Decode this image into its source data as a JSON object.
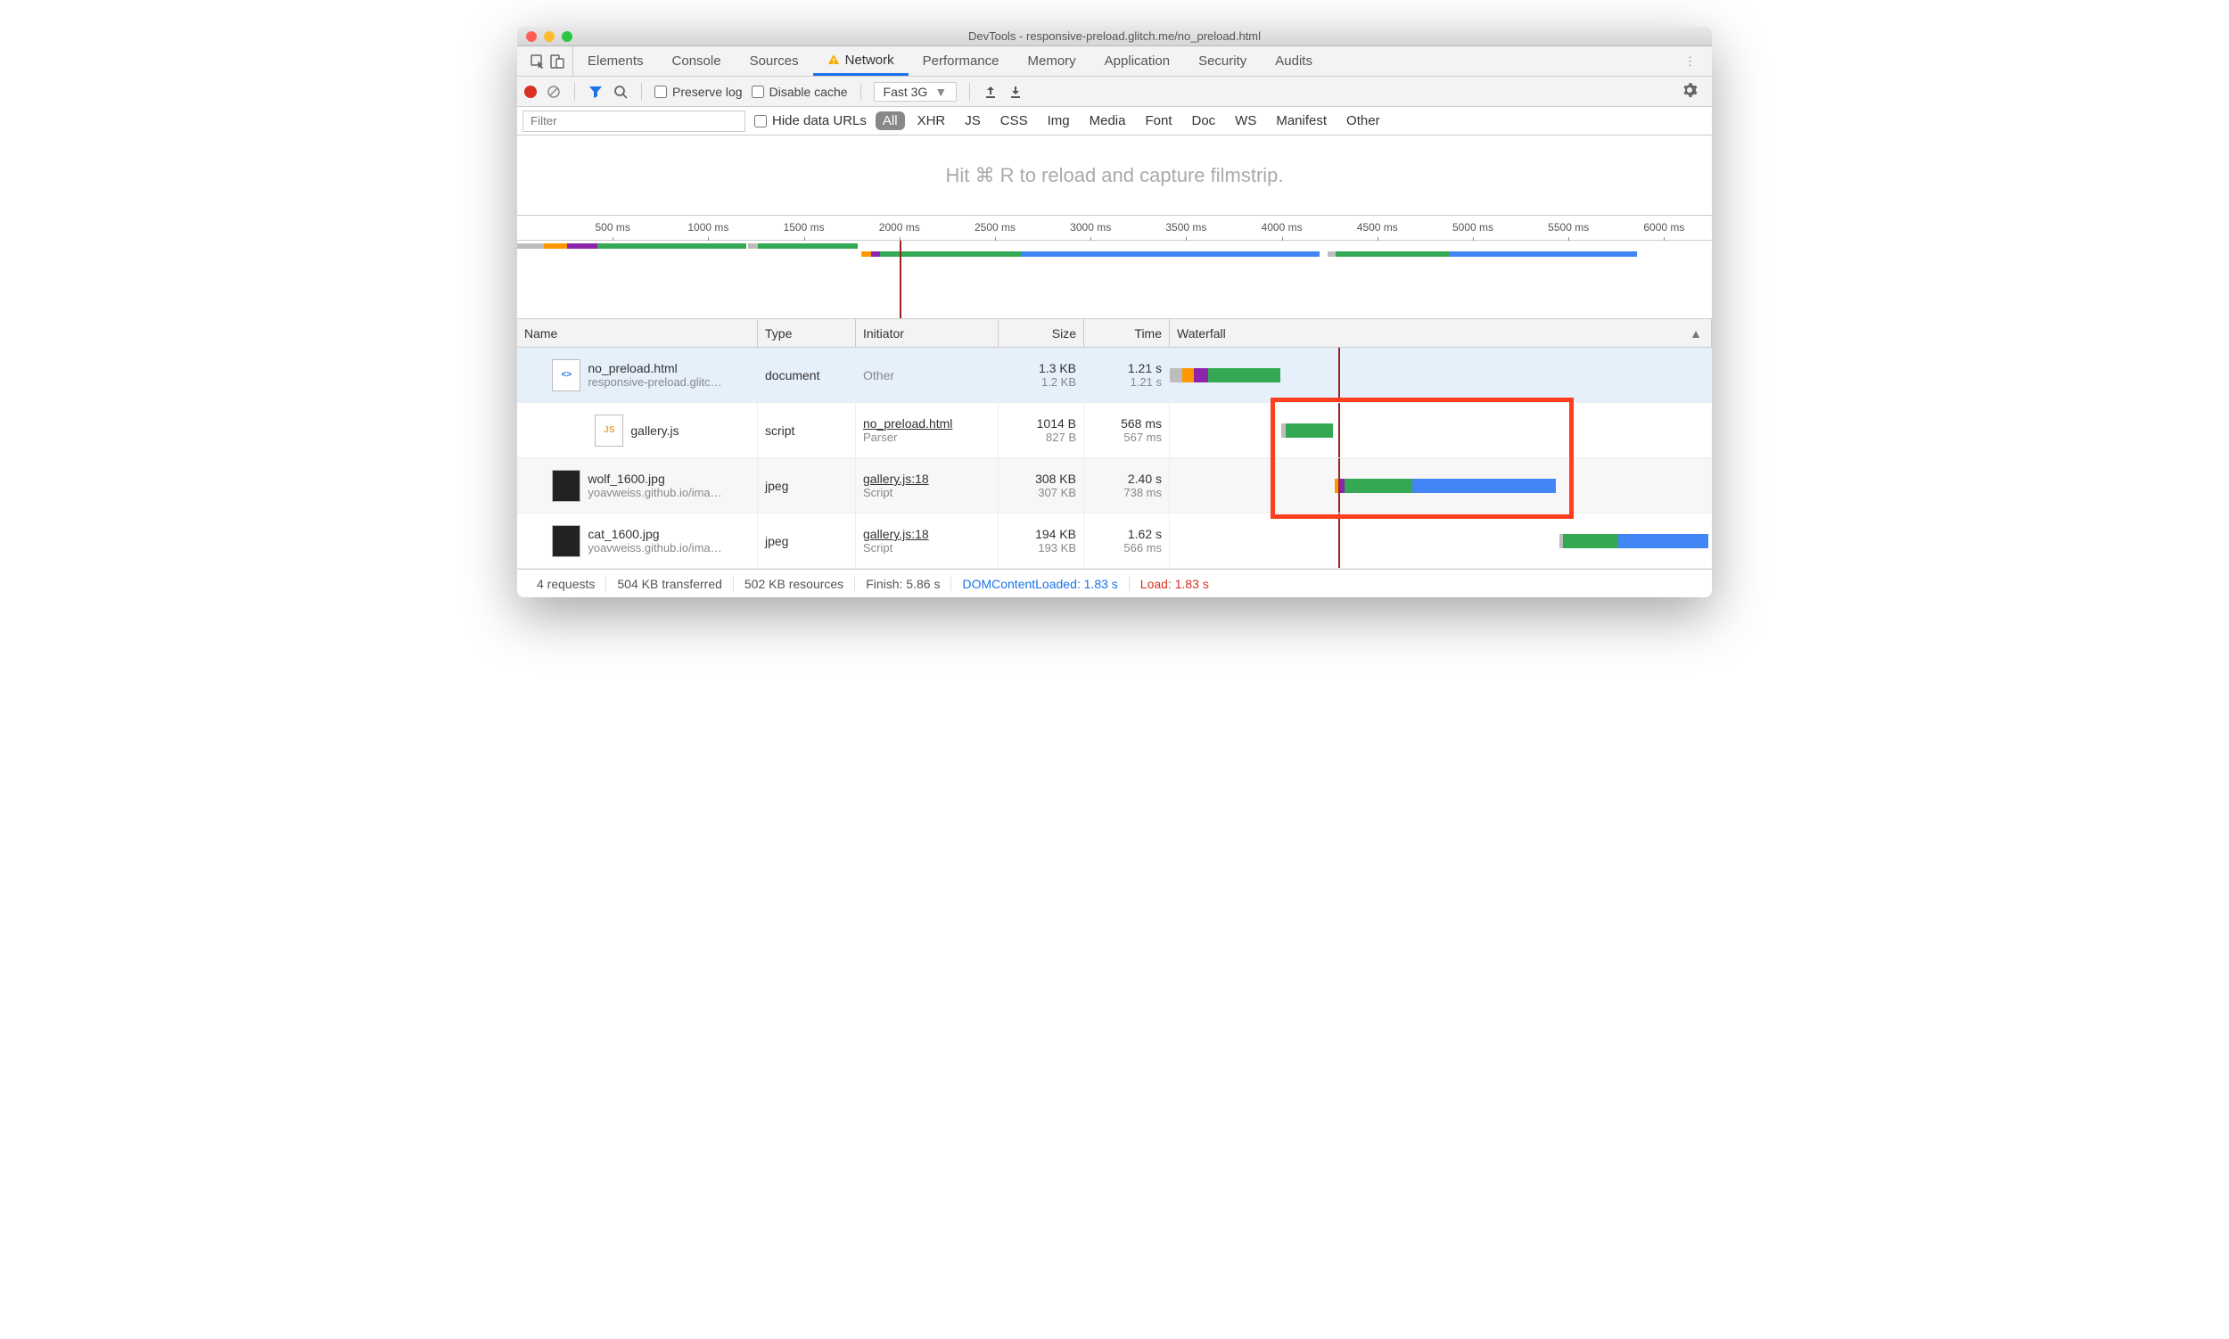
{
  "window_title": "DevTools - responsive-preload.glitch.me/no_preload.html",
  "tabs": [
    "Elements",
    "Console",
    "Sources",
    "Network",
    "Performance",
    "Memory",
    "Application",
    "Security",
    "Audits"
  ],
  "active_tab": "Network",
  "toolbar": {
    "preserve_log": "Preserve log",
    "disable_cache": "Disable cache",
    "throttle": "Fast 3G"
  },
  "filter": {
    "placeholder": "Filter",
    "hide_data_urls": "Hide data URLs",
    "types": [
      "All",
      "XHR",
      "JS",
      "CSS",
      "Img",
      "Media",
      "Font",
      "Doc",
      "WS",
      "Manifest",
      "Other"
    ],
    "active_type": "All"
  },
  "filmstrip_hint": "Hit ⌘ R to reload and capture filmstrip.",
  "overview": {
    "ticks": [
      "500 ms",
      "1000 ms",
      "1500 ms",
      "2000 ms",
      "2500 ms",
      "3000 ms",
      "3500 ms",
      "4000 ms",
      "4500 ms",
      "5000 ms",
      "5500 ms",
      "6000 ms"
    ],
    "max_ms": 6250
  },
  "columns": {
    "name": "Name",
    "type": "Type",
    "initiator": "Initiator",
    "size": "Size",
    "time": "Time",
    "waterfall": "Waterfall"
  },
  "requests": [
    {
      "name": "no_preload.html",
      "sub": "responsive-preload.glitc…",
      "icon": "html",
      "type": "document",
      "initiator": "Other",
      "initiator_sub": "",
      "size": "1.3 KB",
      "size_sub": "1.2 KB",
      "time": "1.21 s",
      "time_sub": "1.21 s",
      "selected": true,
      "wf": [
        {
          "start": 0,
          "end": 140,
          "color": "#bdbdbd"
        },
        {
          "start": 140,
          "end": 260,
          "color": "#ff9800"
        },
        {
          "start": 260,
          "end": 420,
          "color": "#8e24aa"
        },
        {
          "start": 420,
          "end": 1200,
          "color": "#34a853"
        }
      ]
    },
    {
      "name": "gallery.js",
      "sub": "",
      "icon": "js",
      "type": "script",
      "initiator": "no_preload.html",
      "initiator_sub": "Parser",
      "size": "1014 B",
      "size_sub": "827 B",
      "time": "568 ms",
      "time_sub": "567 ms",
      "wf": [
        {
          "start": 1210,
          "end": 1260,
          "color": "#bdbdbd"
        },
        {
          "start": 1260,
          "end": 1780,
          "color": "#34a853"
        }
      ]
    },
    {
      "name": "wolf_1600.jpg",
      "sub": "yoavweiss.github.io/ima…",
      "icon": "img",
      "type": "jpeg",
      "initiator": "gallery.js:18",
      "initiator_sub": "Script",
      "size": "308 KB",
      "size_sub": "307 KB",
      "time": "2.40 s",
      "time_sub": "738 ms",
      "alt": true,
      "wf": [
        {
          "start": 1800,
          "end": 1850,
          "color": "#ff9800"
        },
        {
          "start": 1850,
          "end": 1900,
          "color": "#8e24aa"
        },
        {
          "start": 1900,
          "end": 2640,
          "color": "#34a853"
        },
        {
          "start": 2640,
          "end": 4200,
          "color": "#4285f4"
        }
      ]
    },
    {
      "name": "cat_1600.jpg",
      "sub": "yoavweiss.github.io/ima…",
      "icon": "img",
      "type": "jpeg",
      "initiator": "gallery.js:18",
      "initiator_sub": "Script",
      "size": "194 KB",
      "size_sub": "193 KB",
      "time": "1.62 s",
      "time_sub": "566 ms",
      "wf": [
        {
          "start": 4240,
          "end": 4280,
          "color": "#bdbdbd"
        },
        {
          "start": 4280,
          "end": 4880,
          "color": "#34a853"
        },
        {
          "start": 4880,
          "end": 5860,
          "color": "#4285f4"
        }
      ]
    }
  ],
  "wf_marker_ms": 1830,
  "wf_max_ms": 5900,
  "highlight_row_start": 1,
  "highlight_row_end": 2,
  "summary": {
    "requests": "4 requests",
    "transferred": "504 KB transferred",
    "resources": "502 KB resources",
    "finish": "Finish: 5.86 s",
    "dcl": "DOMContentLoaded: 1.83 s",
    "load": "Load: 1.83 s"
  }
}
